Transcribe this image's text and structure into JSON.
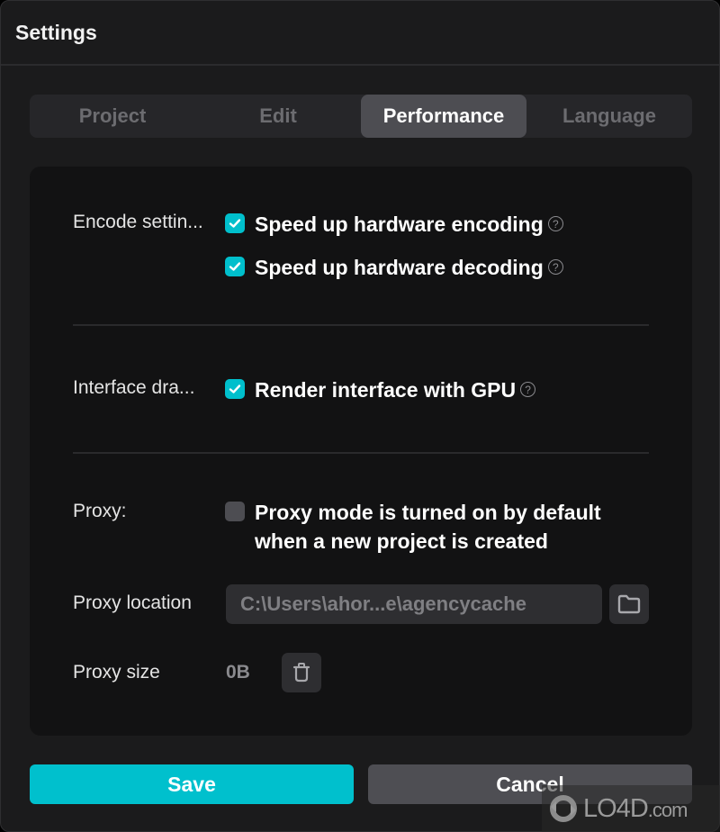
{
  "window": {
    "title": "Settings"
  },
  "tabs": [
    {
      "label": "Project",
      "active": false
    },
    {
      "label": "Edit",
      "active": false
    },
    {
      "label": "Performance",
      "active": true
    },
    {
      "label": "Language",
      "active": false
    }
  ],
  "encode": {
    "label": "Encode settin...",
    "options": [
      {
        "label": "Speed up hardware encoding",
        "checked": true,
        "help_icon": "question-circle-icon"
      },
      {
        "label": "Speed up hardware decoding",
        "checked": true,
        "help_icon": "question-circle-icon"
      }
    ]
  },
  "interface": {
    "label": "Interface dra...",
    "option": {
      "label": "Render interface with GPU",
      "checked": true,
      "help_icon": "question-circle-icon"
    }
  },
  "proxy": {
    "label": "Proxy:",
    "option": {
      "label_line1": "Proxy mode is turned on by default",
      "label_line2": "when a new project is created",
      "checked": false
    },
    "location_label": "Proxy location",
    "location_value": "C:\\Users\\ahor...e\\agencycache",
    "location_icon": "folder-icon",
    "size_label": "Proxy size",
    "size_value": "0B",
    "clear_icon": "trash-icon"
  },
  "footer": {
    "save_label": "Save",
    "cancel_label": "Cancel"
  },
  "colors": {
    "accent": "#00c0cd",
    "active_tab": "#4d4d52",
    "panel": "#121213",
    "window": "#1b1b1c"
  },
  "watermark": {
    "text": "LO4D",
    "suffix": ".com"
  },
  "help_glyph": "?"
}
